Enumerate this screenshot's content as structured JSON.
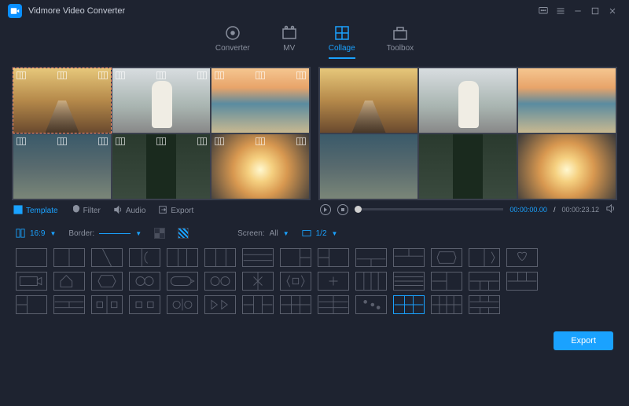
{
  "app": {
    "title": "Vidmore Video Converter"
  },
  "nav": {
    "converter": "Converter",
    "mv": "MV",
    "collage": "Collage",
    "toolbox": "Toolbox",
    "active": "collage"
  },
  "editor_tabs": {
    "template": "Template",
    "filter": "Filter",
    "audio": "Audio",
    "export": "Export"
  },
  "preview": {
    "time_current": "00:00:00.00",
    "time_separator": "/",
    "time_total": "00:00:23.12"
  },
  "options": {
    "aspect": "16:9",
    "border_label": "Border:",
    "screen_label": "Screen:",
    "screen_value": "All",
    "view_value": "1/2"
  },
  "footer": {
    "export": "Export"
  }
}
